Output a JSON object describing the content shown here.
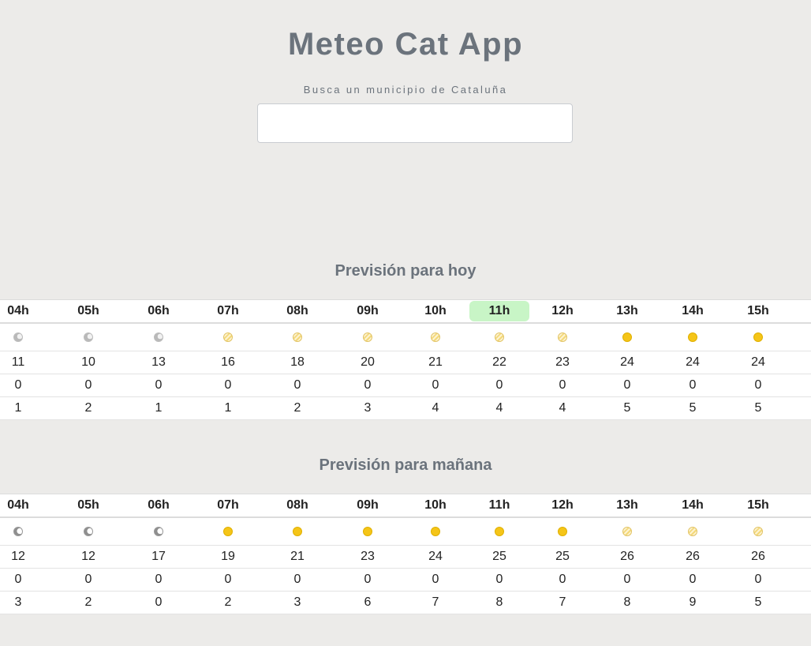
{
  "app": {
    "title": "Meteo Cat App",
    "search_label": "Busca un municipio de Cataluña",
    "search_value": ""
  },
  "today": {
    "title": "Previsión para hoy",
    "hours": [
      "04h",
      "05h",
      "06h",
      "07h",
      "08h",
      "09h",
      "10h",
      "11h",
      "12h",
      "13h",
      "14h",
      "15h"
    ],
    "current_hour_index": 7,
    "icons": [
      "moon-cloud-icon",
      "moon-cloud-icon",
      "moon-cloud-icon",
      "hazy-sun-icon",
      "hazy-sun-icon",
      "hazy-sun-icon",
      "hazy-sun-icon",
      "hazy-sun-icon",
      "hazy-sun-icon",
      "sun-icon",
      "sun-icon",
      "sun-icon"
    ],
    "rows": [
      [
        "11",
        "10",
        "13",
        "16",
        "18",
        "20",
        "21",
        "22",
        "23",
        "24",
        "24",
        "24"
      ],
      [
        "0",
        "0",
        "0",
        "0",
        "0",
        "0",
        "0",
        "0",
        "0",
        "0",
        "0",
        "0"
      ],
      [
        "1",
        "2",
        "1",
        "1",
        "2",
        "3",
        "4",
        "4",
        "4",
        "5",
        "5",
        "5"
      ]
    ]
  },
  "tomorrow": {
    "title": "Previsión para mañana",
    "hours": [
      "04h",
      "05h",
      "06h",
      "07h",
      "08h",
      "09h",
      "10h",
      "11h",
      "12h",
      "13h",
      "14h",
      "15h"
    ],
    "icons": [
      "moon-icon",
      "moon-icon",
      "moon-icon",
      "sun-icon",
      "sun-icon",
      "sun-icon",
      "sun-icon",
      "sun-icon",
      "sun-icon",
      "hazy-sun-icon",
      "hazy-sun-icon",
      "hazy-sun-icon"
    ],
    "rows": [
      [
        "12",
        "12",
        "17",
        "19",
        "21",
        "23",
        "24",
        "25",
        "25",
        "26",
        "26",
        "26"
      ],
      [
        "0",
        "0",
        "0",
        "0",
        "0",
        "0",
        "0",
        "0",
        "0",
        "0",
        "0",
        "0"
      ],
      [
        "3",
        "2",
        "0",
        "2",
        "3",
        "6",
        "7",
        "8",
        "7",
        "8",
        "9",
        "5"
      ]
    ]
  },
  "colors": {
    "background": "#ecebe9",
    "title": "#6b737c",
    "current_hour_highlight": "#c8f5c6",
    "sun": "#f5c518"
  }
}
